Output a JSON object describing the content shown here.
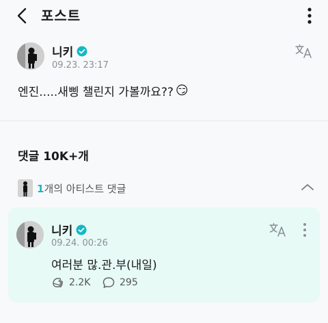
{
  "header": {
    "title": "포스트"
  },
  "post": {
    "author": "니키",
    "timestamp": "09.23. 23:17",
    "text": "엔진.....새삥 챌린지 가볼까요??",
    "emoji": "😏"
  },
  "comments": {
    "count_label": "댓글 10K+개",
    "artist_count": "1",
    "artist_label": "개의 아티스트 댓글"
  },
  "artist_comment": {
    "author": "니키",
    "timestamp": "09.24. 00:26",
    "text": "여러분 많.관.부(내일)",
    "likes": "2.2K",
    "replies": "295"
  },
  "colors": {
    "verified": "#14b8c4",
    "card_bg": "#e7faf6",
    "accent": "#14b8c4"
  }
}
